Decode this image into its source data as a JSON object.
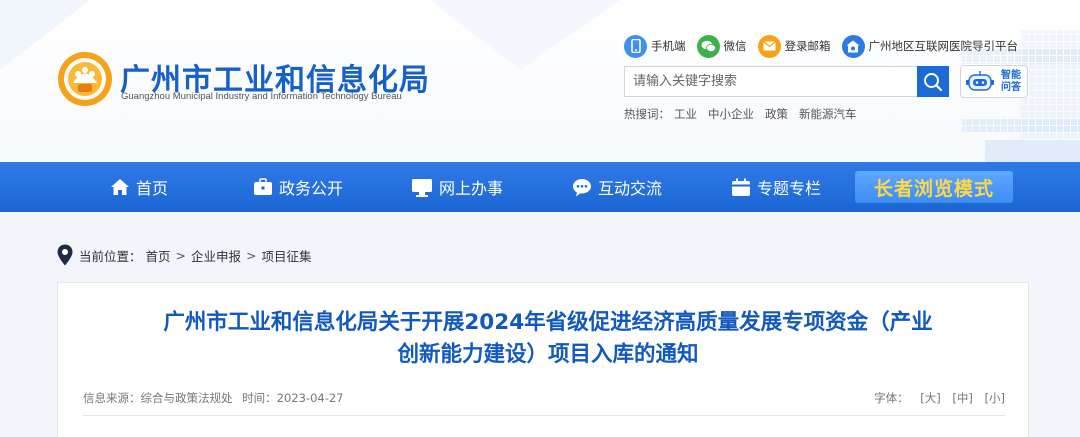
{
  "header": {
    "logo_cn": "广州市工业和信息化局",
    "logo_en": "Guangzhou Municipal Industry and Information Technology Bureau",
    "quick_links": [
      {
        "label": "手机端",
        "icon": "mobile-icon",
        "color": "#3d8ff0"
      },
      {
        "label": "微信",
        "icon": "wechat-icon",
        "color": "#3cb34a"
      },
      {
        "label": "登录邮箱",
        "icon": "mail-icon",
        "color": "#f5a417"
      },
      {
        "label": "广州地区互联网医院导引平台",
        "icon": "hospital-icon",
        "color": "#2d7be2"
      }
    ],
    "search": {
      "placeholder": "请输入关键字搜索",
      "value": ""
    },
    "robot": {
      "line1": "智能",
      "line2": "问答"
    },
    "hot_label": "热搜词：",
    "hot_words": [
      "工业",
      "中小企业",
      "政策",
      "新能源汽车"
    ]
  },
  "nav": {
    "items": [
      {
        "label": "首页",
        "icon": "home-icon"
      },
      {
        "label": "政务公开",
        "icon": "briefcase-icon"
      },
      {
        "label": "网上办事",
        "icon": "monitor-icon"
      },
      {
        "label": "互动交流",
        "icon": "chat-icon"
      },
      {
        "label": "专题专栏",
        "icon": "calendar-icon"
      }
    ],
    "elder_mode": "长者浏览模式"
  },
  "breadcrumb": {
    "prefix": "当前位置：",
    "items": [
      "首页",
      "企业申报",
      "项目征集"
    ],
    "sep": ">"
  },
  "article": {
    "title_line1": "广州市工业和信息化局关于开展2024年省级促进经济高质量发展专项资金（产业",
    "title_line2": "创新能力建设）项目入库的通知",
    "source_label": "信息来源：",
    "source": "综合与政策法规处",
    "time_label": "时间：",
    "time": "2023-04-27",
    "font_label": "字体：",
    "font_sizes": [
      "[大]",
      "[中]",
      "[小]"
    ]
  },
  "colors": {
    "brand_blue": "#1561c9",
    "nav_blue": "#1b66d3",
    "elder_text": "#ffd84a",
    "title_blue": "#1159c0"
  }
}
